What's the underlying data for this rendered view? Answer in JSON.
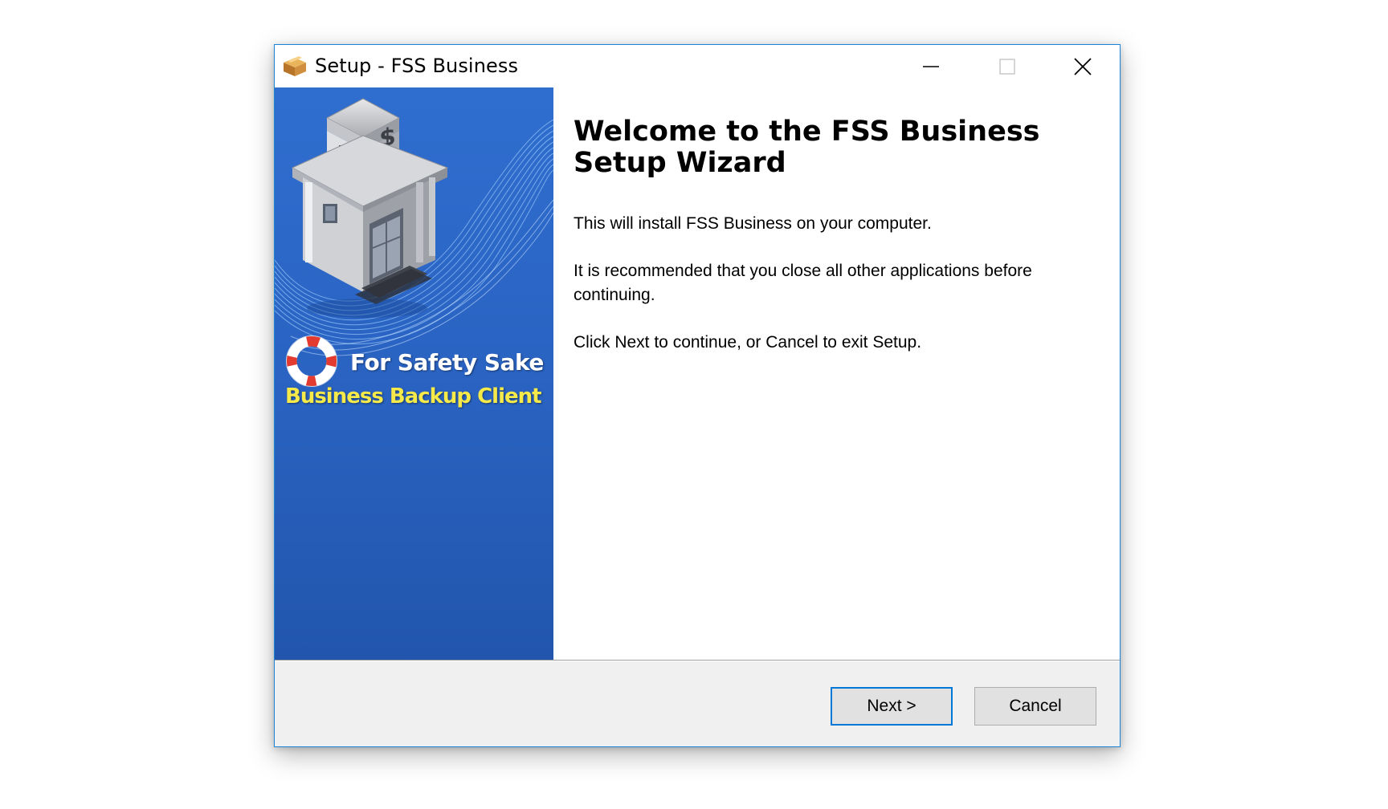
{
  "window": {
    "title": "Setup - FSS Business",
    "icon": "setup-package-icon",
    "controls": {
      "minimize": "minimize-icon",
      "maximize": "maximize-icon",
      "close": "close-icon"
    }
  },
  "side_image": {
    "brand_line1": "For Safety Sake",
    "brand_line2": "Business Backup Client",
    "colors": {
      "background": "#2a66c5",
      "brand_line1": "#ffffff",
      "brand_line2": "#f5ea4a"
    }
  },
  "main": {
    "heading": "Welcome to the FSS Business Setup Wizard",
    "paragraphs": [
      "This will install FSS Business on your computer.",
      "It is recommended that you close all other applications before continuing.",
      "Click Next to continue, or Cancel to exit Setup."
    ]
  },
  "buttons": {
    "next": "Next >",
    "cancel": "Cancel"
  },
  "colors": {
    "accent": "#0078d7",
    "window_border": "#1883d7"
  }
}
